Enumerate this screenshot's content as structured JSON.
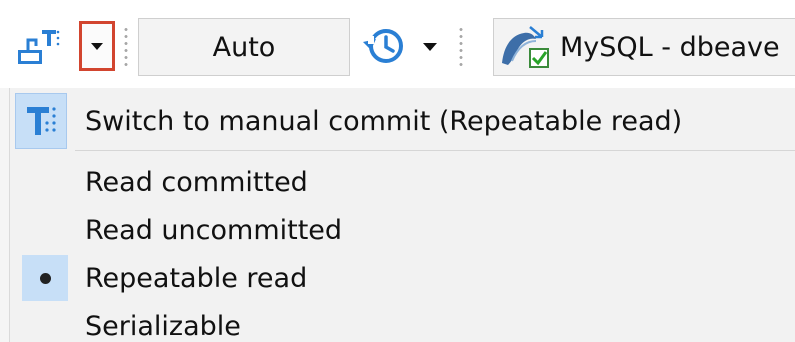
{
  "toolbar": {
    "transaction_mode_label": "Auto",
    "connection_label": "MySQL - dbeave",
    "icons": {
      "commit_mode": "transaction-mode-icon",
      "dropdown": "chevron-down-icon",
      "history": "history-icon",
      "connection": "mysql-connection-icon"
    }
  },
  "menu": {
    "switch_item": "Switch to manual commit (Repeatable read)",
    "isolation_levels": [
      {
        "label": "Read committed",
        "selected": false
      },
      {
        "label": "Read uncommitted",
        "selected": false
      },
      {
        "label": "Repeatable read",
        "selected": true
      },
      {
        "label": "Serializable",
        "selected": false
      }
    ]
  },
  "colors": {
    "highlight_border": "#d2452f",
    "selection_bg": "#c7dff7",
    "icon_blue": "#2a7fd4"
  }
}
